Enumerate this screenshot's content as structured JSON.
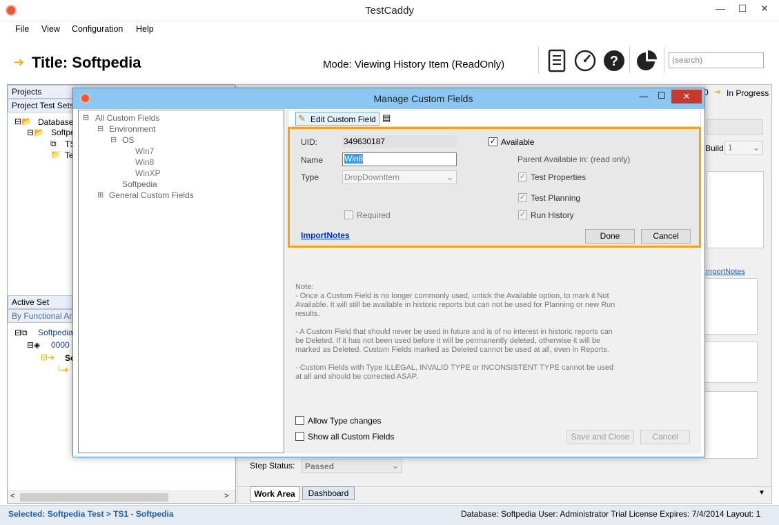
{
  "window": {
    "title": "TestCaddy",
    "minimize": "—",
    "maximize": "☐",
    "close": "✕"
  },
  "menu": [
    "File",
    "View",
    "Configuration",
    "Help"
  ],
  "header": {
    "title": "Title:  Softpedia",
    "mode": "Mode:   Viewing History Item  (ReadOnly)",
    "search_placeholder": "(search)"
  },
  "left": {
    "projects_label": "Projects",
    "project_test_sets_label": "Project Test Sets",
    "tree": [
      "Database:",
      "Softpe",
      "TS",
      "Te"
    ],
    "active_set_label": "Active Set",
    "functional_area_label": "By Functional Are",
    "active_tree": [
      "Softpedia",
      "0000 -",
      "So"
    ]
  },
  "right": {
    "status": "In Progress",
    "status_prefix": "0",
    "build_label": "Build",
    "build_value": "1",
    "importnotes_link": "ImportNotes",
    "step_status_label": "Step Status:",
    "step_status_value": "Passed",
    "tabs": [
      "Work Area",
      "Dashboard"
    ]
  },
  "statusbar": {
    "selected": "Selected:  Softpedia Test > TS1 - Softpedia",
    "info": "Database:  Softpedia   User: Administrator   Trial License Expires: 7/4/2014   Layout: 1"
  },
  "dialog": {
    "title": "Manage Custom Fields",
    "tree": {
      "root": "All Custom Fields",
      "environment": "Environment",
      "os": "OS",
      "win7": "Win7",
      "win8": "Win8",
      "winxp": "WinXP",
      "softpedia": "Softpedia",
      "general": "General Custom Fields"
    },
    "toolbar": {
      "edit_label": "Edit Custom Field"
    },
    "form": {
      "uid_label": "UID:",
      "uid_value": "349630187",
      "name_label": "Name",
      "name_value": "Win8",
      "type_label": "Type",
      "type_value": "DropDownItem",
      "required_label": "Required",
      "available_label": "Available",
      "parent_label": "Parent Available in: (read only)",
      "test_properties": "Test Properties",
      "test_planning": "Test Planning",
      "run_history": "Run History",
      "importnotes": "ImportNotes",
      "done": "Done",
      "cancel": "Cancel"
    },
    "note": {
      "title": "Note:",
      "p1": " - Once a Custom Field is no longer commonly used, untick the Available option, to mark it Not Available. It will still be available in historic reports but can not be used for Planning or new Run results.",
      "p2": " - A Custom Field that should never be used in future and is of no interest in historic reports can be Deleted.  If it has not been used before it will be permanently deleted, otherwise it will be marked as Deleted.  Custom Fields marked as Deleted cannot be used at all, even in Reports.",
      "p3": " - Custom Fields with Type ILLEGAL, INVALID TYPE or INCONSISTENT TYPE cannot be used at all and should be corrected ASAP."
    },
    "allow_type_changes": "Allow Type changes",
    "show_all": "Show all Custom Fields",
    "save_close": "Save and Close",
    "cancel": "Cancel"
  }
}
